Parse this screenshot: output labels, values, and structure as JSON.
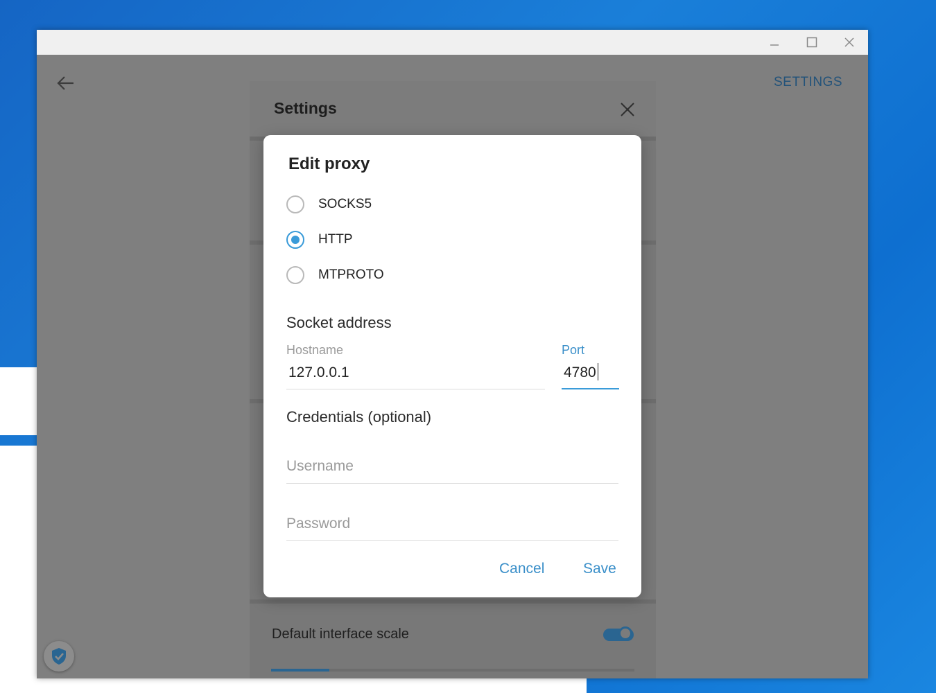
{
  "window": {
    "controls": {
      "minimize": "minimize-icon",
      "maximize": "maximize-icon",
      "close": "close-icon"
    },
    "header_link": "SETTINGS"
  },
  "settings_panel": {
    "title": "Settings",
    "default_scale_label": "Default interface scale",
    "default_scale_on": true
  },
  "dialog": {
    "title": "Edit proxy",
    "proxy_types": [
      {
        "label": "SOCKS5",
        "selected": false
      },
      {
        "label": "HTTP",
        "selected": true
      },
      {
        "label": "MTPROTO",
        "selected": false
      }
    ],
    "socket_section": "Socket address",
    "hostname_label": "Hostname",
    "hostname_value": "127.0.0.1",
    "port_label": "Port",
    "port_value": "4780",
    "credentials_section": "Credentials (optional)",
    "username_placeholder": "Username",
    "password_placeholder": "Password",
    "cancel_label": "Cancel",
    "save_label": "Save"
  },
  "colors": {
    "accent": "#3a9bd9",
    "desk_blue": "#1a7fd9"
  }
}
